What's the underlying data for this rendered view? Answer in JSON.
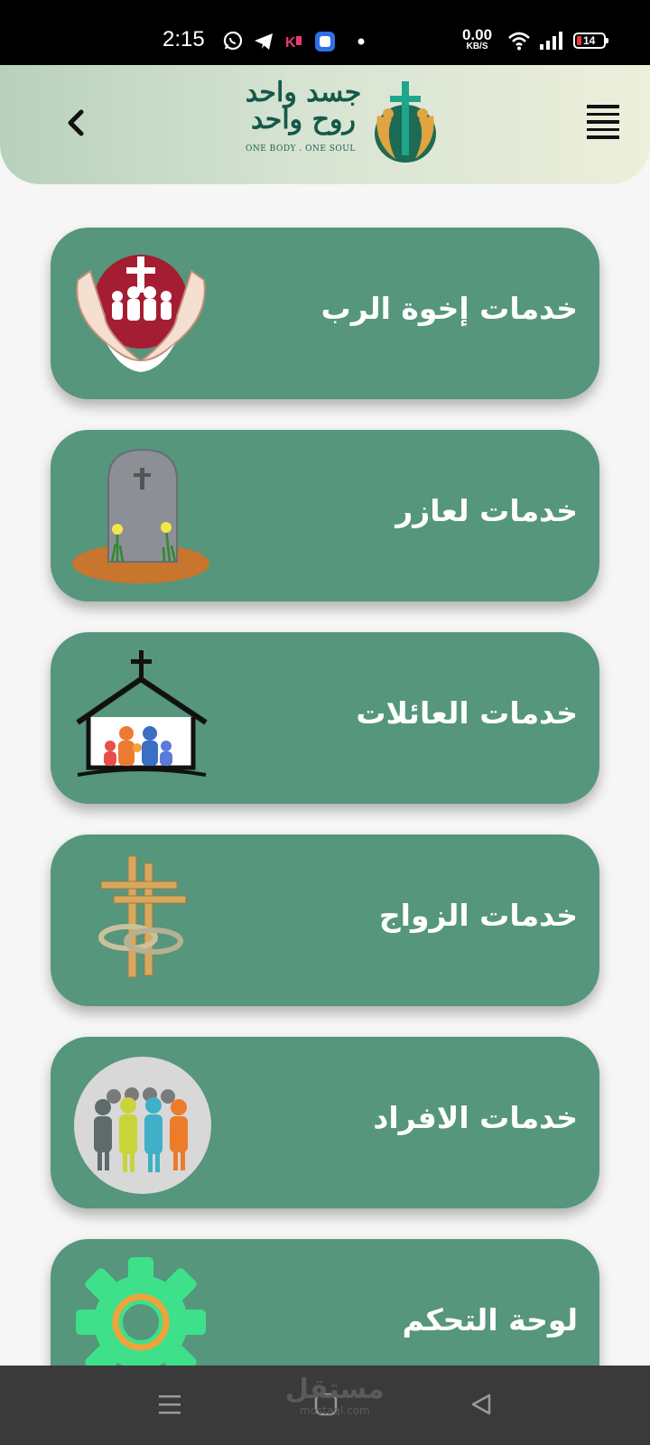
{
  "status_bar": {
    "time": "2:15",
    "net_speed_value": "0.00",
    "net_speed_unit": "KB/S",
    "battery_level": "14",
    "icons": [
      "whatsapp-icon",
      "telegram-icon",
      "app-notification-icon",
      "app-notification-icon",
      "dot-icon",
      "wifi-icon",
      "signal-icon",
      "battery-icon"
    ]
  },
  "header": {
    "logo_line1": "جسد واحد",
    "logo_line2": "روح واحد",
    "logo_tagline": "ONE BODY . ONE SOUL",
    "back_icon": "chevron-left-icon",
    "menu_icon": "hamburger-menu-icon"
  },
  "menu": {
    "items": [
      {
        "label": "خدمات إخوة الرب",
        "icon": "hands-family-cross-icon"
      },
      {
        "label": "خدمات لعازر",
        "icon": "gravestone-icon"
      },
      {
        "label": "خدمات العائلات",
        "icon": "church-family-icon"
      },
      {
        "label": "خدمات الزواج",
        "icon": "crosses-rings-icon"
      },
      {
        "label": "خدمات الافراد",
        "icon": "people-group-icon"
      },
      {
        "label": "لوحة التحكم",
        "icon": "gear-icon"
      }
    ]
  },
  "nav_bar": {
    "watermark_ar": "مستقل",
    "watermark_en": "mostaql.com",
    "icons": [
      "menu-nav-icon",
      "home-nav-icon",
      "back-nav-icon"
    ]
  },
  "colors": {
    "card_bg": "#55967c",
    "header_gradient_start": "#b8d1bc",
    "header_gradient_end": "#edefdb",
    "logo_green": "#145a4a",
    "background": "#f6f6f6"
  }
}
